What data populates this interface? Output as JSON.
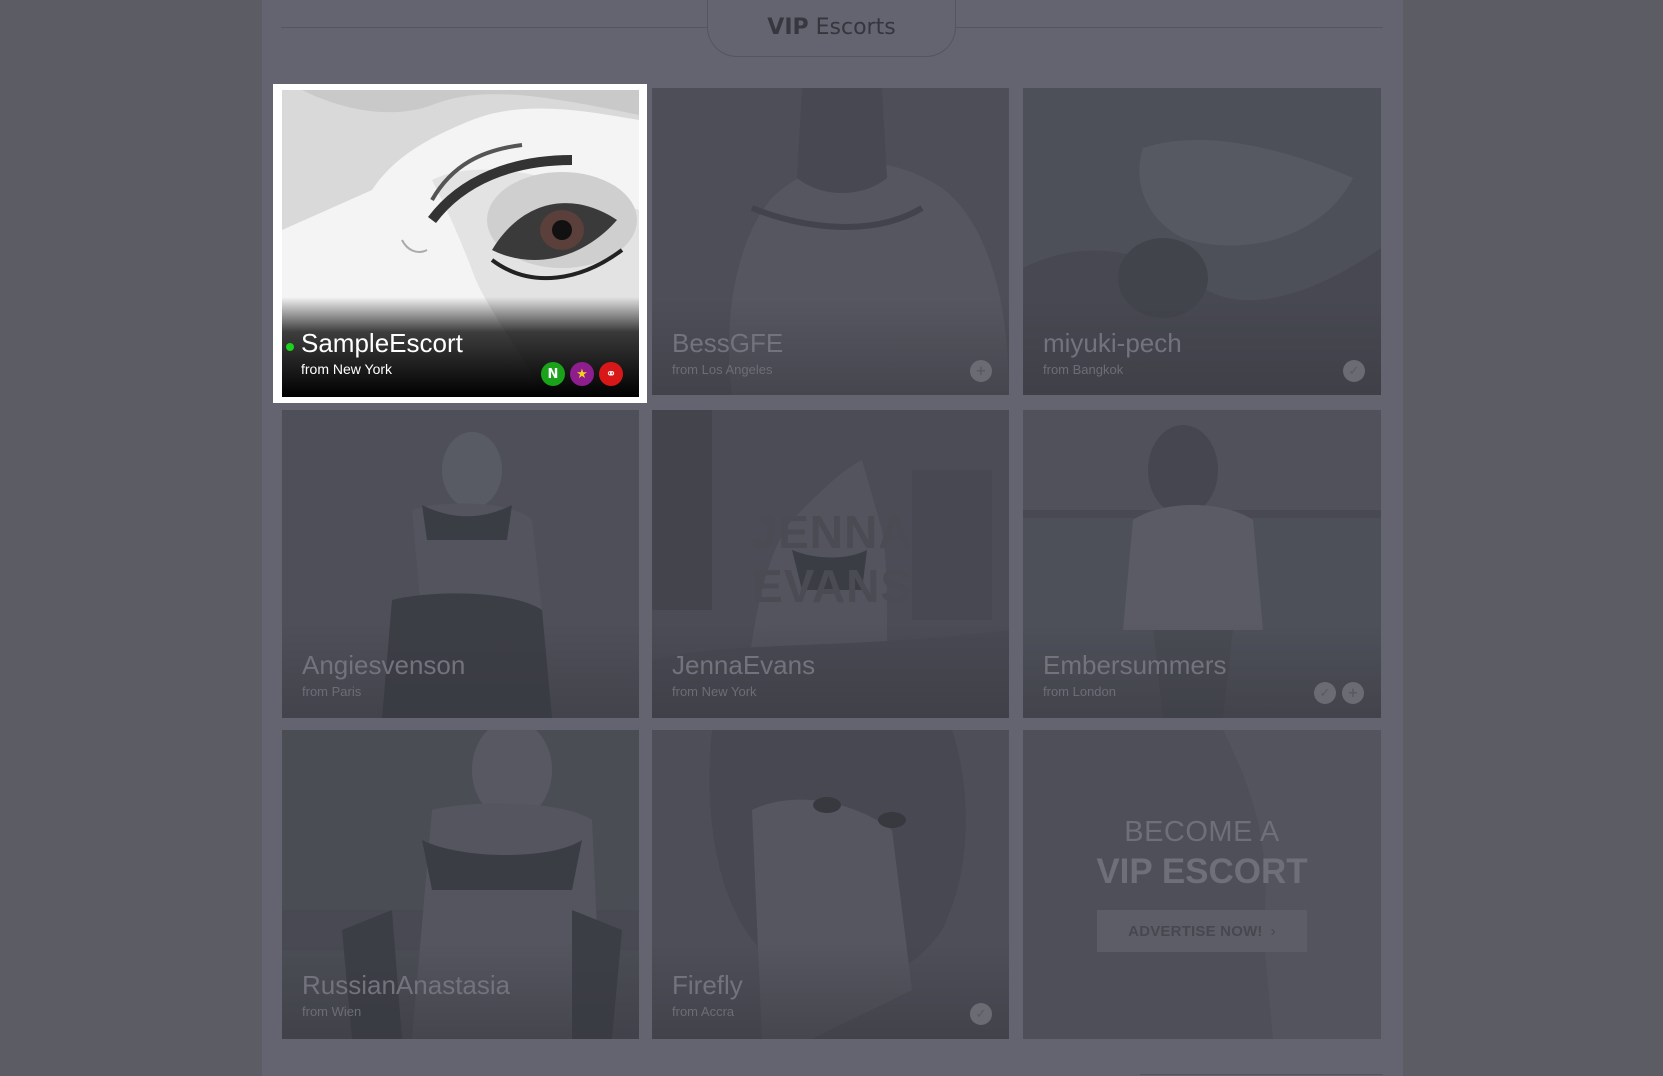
{
  "section": {
    "title_bold": "VIP",
    "title_rest": "Escorts"
  },
  "featured": {
    "name": "SampleEscort",
    "from": "from New York",
    "badges": [
      {
        "icon": "new-badge-icon",
        "text": "N",
        "color": "#1aa21a"
      },
      {
        "icon": "star-badge-icon",
        "text": "★",
        "color": "#8e1d8e"
      },
      {
        "icon": "handcuffs-badge-icon",
        "text": "⚭",
        "color": "#d81818"
      }
    ]
  },
  "cards": [
    {
      "name": "BessGFE",
      "from": "from Los Angeles",
      "badges": [
        "+"
      ]
    },
    {
      "name": "miyuki-pech",
      "from": "from Bangkok",
      "badges": [
        "✓"
      ]
    },
    {
      "name": "Angiesvenson",
      "from": "from Paris",
      "badges": []
    },
    {
      "name": "JennaEvans",
      "from": "from New York",
      "badges": [],
      "watermark": "JENNA EVANS"
    },
    {
      "name": "Embersummers",
      "from": "from London",
      "badges": [
        "✓",
        "+"
      ]
    },
    {
      "name": "RussianAnastasia",
      "from": "from Wien",
      "badges": []
    },
    {
      "name": "Firefly",
      "from": "from Accra",
      "badges": [
        "✓"
      ]
    }
  ],
  "advertise": {
    "line1": "BECOME A",
    "line2": "VIP ESCORT",
    "button": "ADVERTISE NOW!",
    "button_arrow": "›"
  }
}
